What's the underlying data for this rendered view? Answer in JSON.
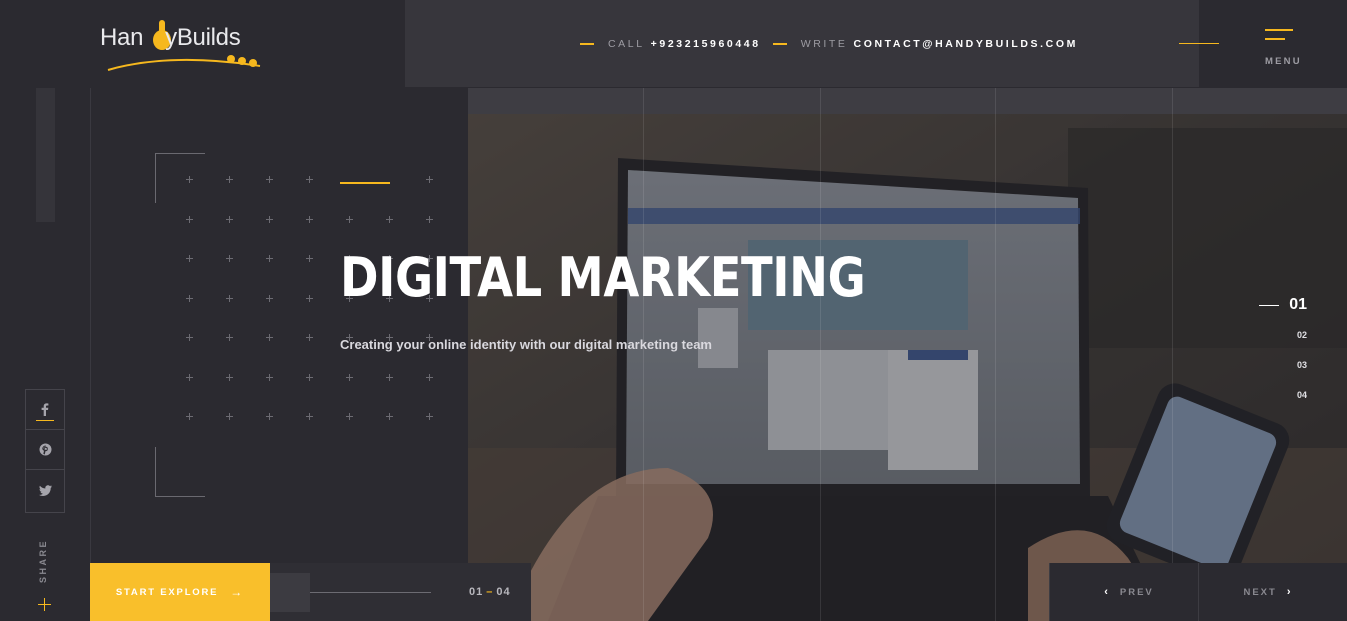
{
  "brand": {
    "name": "HandyBuilds",
    "name_part1": "Han",
    "name_part2": "yBuilds",
    "accent_color": "#f6b81e"
  },
  "header": {
    "call_label": "CALL",
    "call_value": "+923215960448",
    "write_label": "WRITE",
    "write_value": "CONTACT@HANDYBUILDS.COM",
    "menu_label": "MENU"
  },
  "hero": {
    "title": "DIGITAL MARKETING",
    "subtitle": "Creating your online identity with our digital marketing team"
  },
  "slides": {
    "active": "01",
    "items": [
      "02",
      "03",
      "04"
    ]
  },
  "social": {
    "share_label": "SHARE",
    "icons": [
      "facebook-icon",
      "pinterest-icon",
      "twitter-icon"
    ]
  },
  "footer": {
    "explore_label": "START EXPLORE",
    "counter_current": "01",
    "counter_sep": "–",
    "counter_total": "04",
    "prev_label": "PREV",
    "next_label": "NEXT"
  }
}
